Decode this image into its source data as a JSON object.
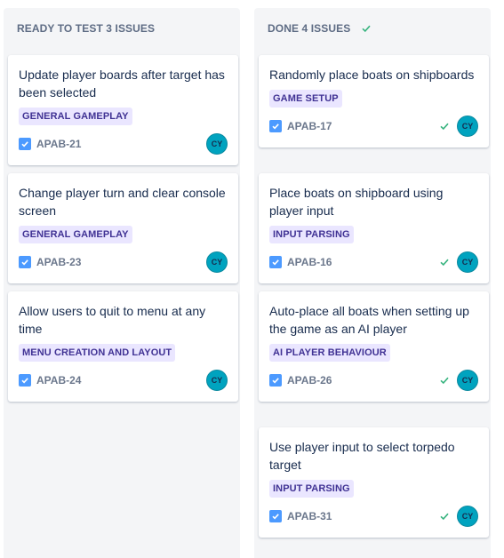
{
  "columns": [
    {
      "title": "READY TO TEST 3 ISSUES",
      "cards": [
        {
          "title": "Update player boards after target has been selected",
          "tag": "GENERAL GAMEPLAY",
          "key": "APAB-21",
          "avatar": "CY"
        },
        {
          "title": "Change player turn and clear console screen",
          "tag": "GENERAL GAMEPLAY",
          "key": "APAB-23",
          "avatar": "CY"
        },
        {
          "title": "Allow users to quit to menu at any time",
          "tag": "MENU CREATION AND LAYOUT",
          "key": "APAB-24",
          "avatar": "CY"
        }
      ]
    },
    {
      "title": "DONE 4 ISSUES",
      "cards": [
        {
          "title": "Randomly place boats on shipboards",
          "tag": "GAME SETUP",
          "key": "APAB-17",
          "avatar": "CY"
        },
        {
          "title": "Place boats on shipboard using player input",
          "tag": "INPUT PARSING",
          "key": "APAB-16",
          "avatar": "CY"
        },
        {
          "title": "Auto-place all boats when setting up the game as an AI player",
          "tag": "AI PLAYER BEHAVIOUR",
          "key": "APAB-26",
          "avatar": "CY"
        },
        {
          "title": "Use player input to select torpedo target",
          "tag": "INPUT PARSING",
          "key": "APAB-31",
          "avatar": "CY"
        }
      ]
    }
  ],
  "colors": {
    "tag_bg": "#eae6ff",
    "tag_text": "#403294",
    "avatar_bg": "#00a3bf",
    "done_check": "#36b37e",
    "checkbox": "#4c9aff",
    "column_bg": "#f4f5f7"
  }
}
